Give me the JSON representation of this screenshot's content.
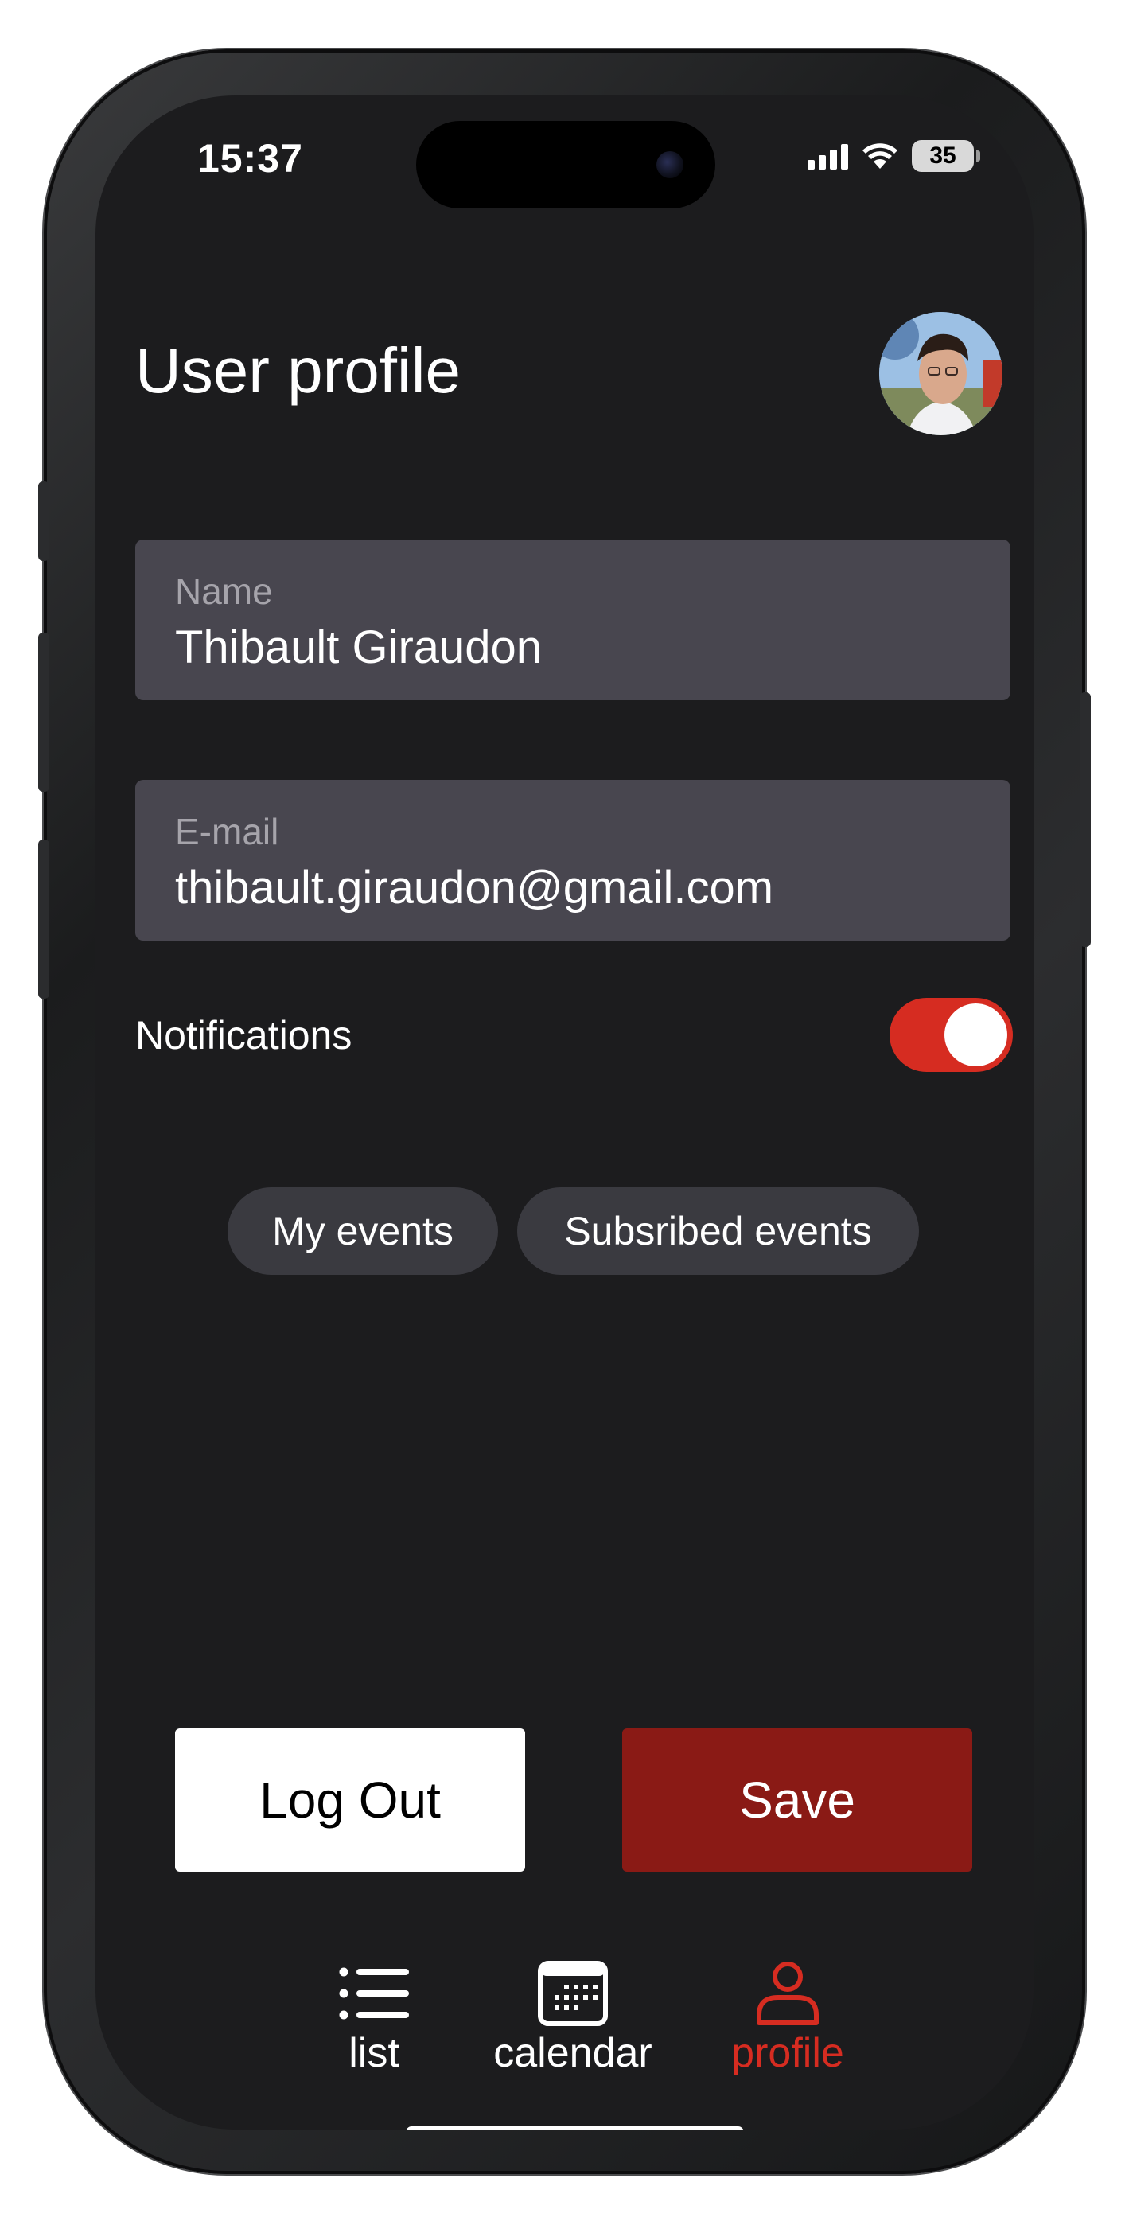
{
  "status_bar": {
    "time": "15:37",
    "battery": "35"
  },
  "header": {
    "title": "User profile"
  },
  "form": {
    "name": {
      "label": "Name",
      "value": "Thibault Giraudon"
    },
    "email": {
      "label": "E-mail",
      "value": "thibault.giraudon@gmail.com"
    }
  },
  "notifications": {
    "label": "Notifications",
    "enabled": true
  },
  "event_tabs": {
    "my_events": "My events",
    "subscribed_events": "Subsribed events"
  },
  "actions": {
    "logout_label": "Log Out",
    "save_label": "Save"
  },
  "tab_bar": {
    "items": [
      {
        "label": "list",
        "icon": "list-icon",
        "active": false
      },
      {
        "label": "calendar",
        "icon": "calendar-icon",
        "active": false
      },
      {
        "label": "profile",
        "icon": "person-icon",
        "active": true
      }
    ]
  },
  "colors": {
    "accent": "#d62c21",
    "save_button": "#8a1a15",
    "background": "#1c1c1e",
    "field": "#48464f"
  }
}
